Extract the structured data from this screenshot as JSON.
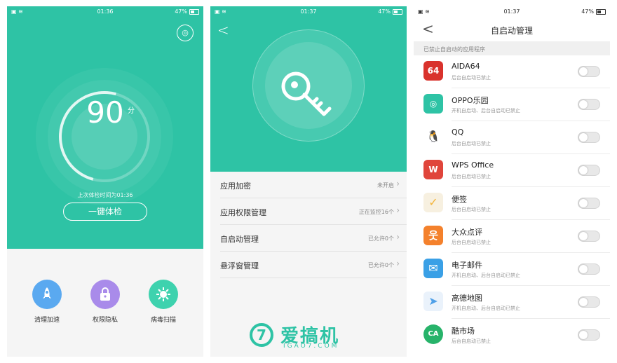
{
  "panel1": {
    "status": {
      "time": "01:36",
      "battery": "47%"
    },
    "score": "90",
    "score_unit": "分",
    "last_check": "上次体检时间为01:36",
    "check_button": "一键体检",
    "tools": [
      {
        "label": "清理加速",
        "icon": "rocket-icon",
        "color": "#5aa9f0",
        "glyph": "🚀"
      },
      {
        "label": "权限隐私",
        "icon": "lock-icon",
        "color": "#a98bea",
        "glyph": "🔒"
      },
      {
        "label": "病毒扫描",
        "icon": "virus-icon",
        "color": "#3ed2ae",
        "glyph": "✹"
      }
    ]
  },
  "panel2": {
    "status": {
      "time": "01:37",
      "battery": "47%"
    },
    "rows": [
      {
        "title": "应用加密",
        "value": "未开启"
      },
      {
        "title": "应用权限管理",
        "value": "正在监控16个"
      },
      {
        "title": "自启动管理",
        "value": "已允许0个"
      },
      {
        "title": "悬浮窗管理",
        "value": "已允许0个"
      }
    ],
    "watermark": {
      "name": "爱搞机",
      "url": "IGAO7.COM",
      "badge": "7"
    }
  },
  "panel3": {
    "status": {
      "time": "01:37",
      "battery": "47%"
    },
    "title": "自启动管理",
    "section": "已禁止自启动的应用程序",
    "apps": [
      {
        "name": "AIDA64",
        "desc": "后台自启动已禁止",
        "badge": "64",
        "color": "#d9322c"
      },
      {
        "name": "OPPO乐园",
        "desc": "开机自启动、后台自启动已禁止",
        "badge": "◎",
        "color": "#2ec3a5"
      },
      {
        "name": "QQ",
        "desc": "后台自启动已禁止",
        "badge": "🐧",
        "color": "#ffffff"
      },
      {
        "name": "WPS Office",
        "desc": "后台自启动已禁止",
        "badge": "W",
        "color": "#e0453b"
      },
      {
        "name": "便签",
        "desc": "后台自启动已禁止",
        "badge": "✓",
        "color": "#f3b43a"
      },
      {
        "name": "大众点评",
        "desc": "后台自启动已禁止",
        "badge": "웃",
        "color": "#f4812c"
      },
      {
        "name": "电子邮件",
        "desc": "开机自启动、后台自启动已禁止",
        "badge": "✉",
        "color": "#3aa0e6"
      },
      {
        "name": "高德地图",
        "desc": "开机自启动、后台自启动已禁止",
        "badge": "➤",
        "color": "#4fa0e8"
      },
      {
        "name": "酷市场",
        "desc": "后台自启动已禁止",
        "badge": "CA",
        "color": "#27b36a"
      }
    ]
  }
}
